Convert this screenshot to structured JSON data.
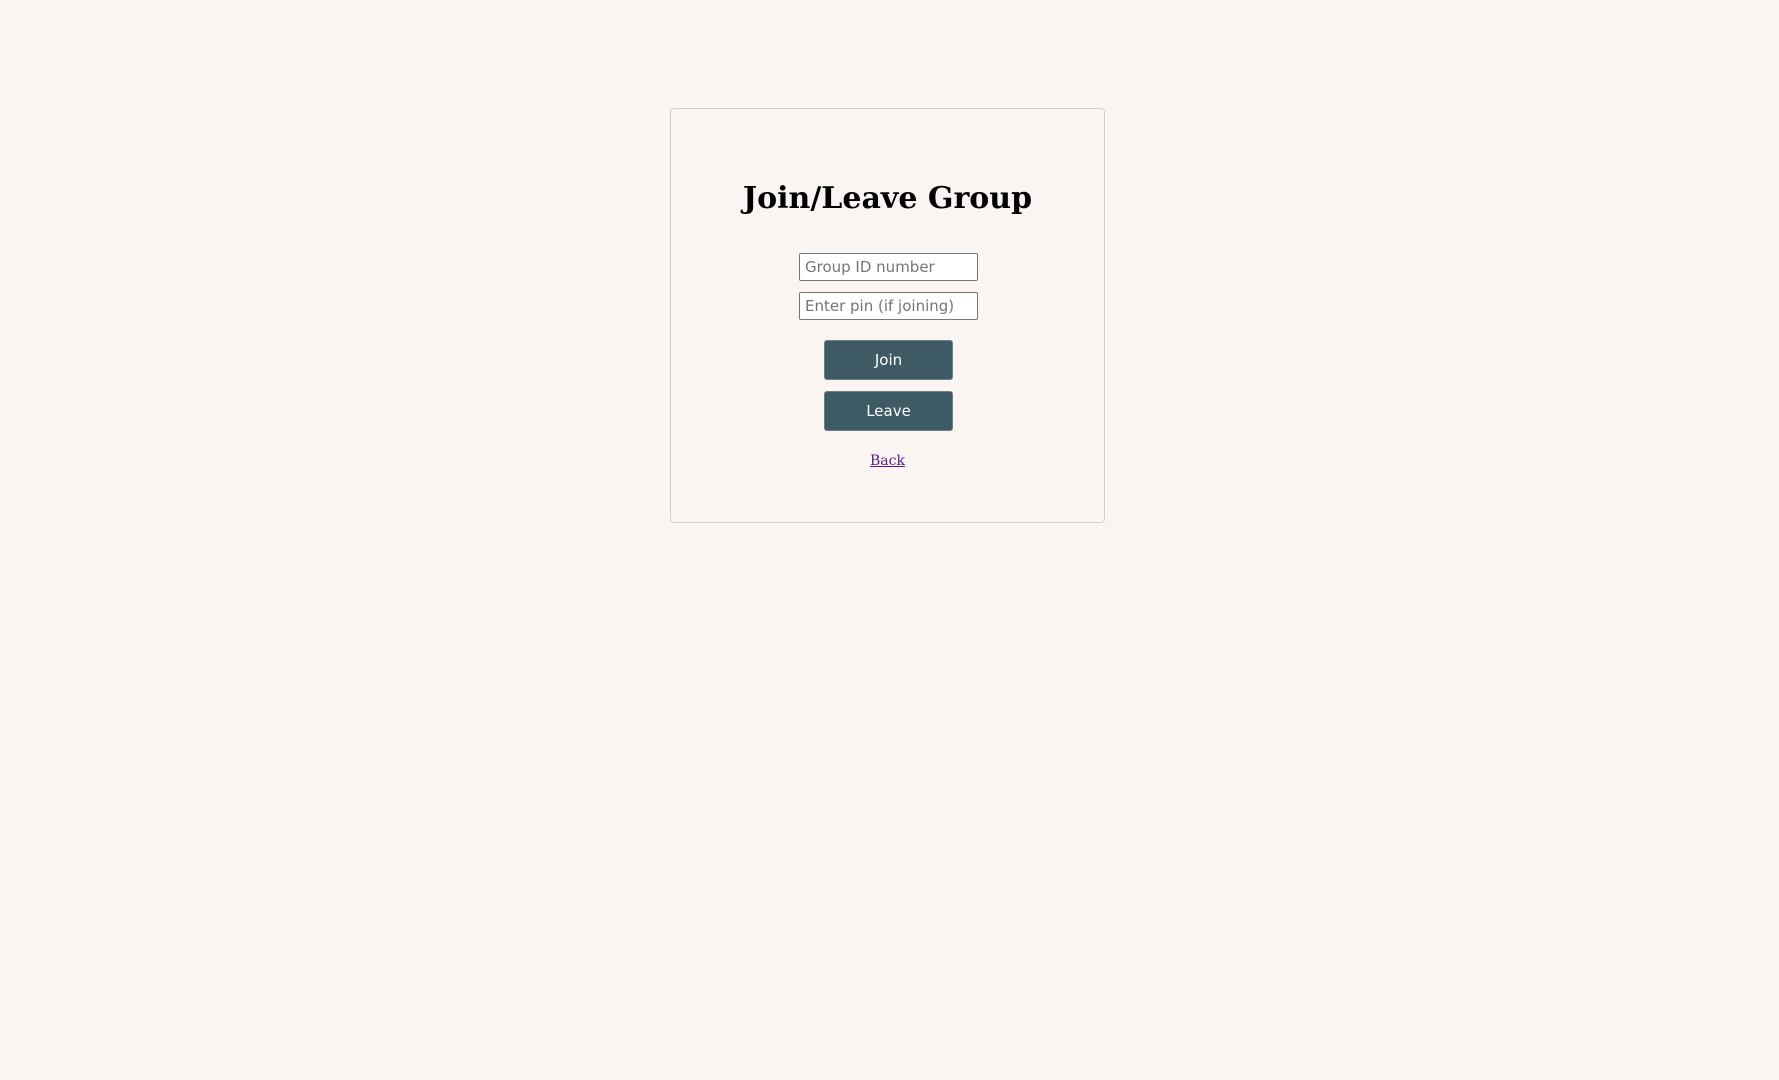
{
  "card": {
    "title": "Join/Leave Group"
  },
  "form": {
    "group_id_placeholder": "Group ID number",
    "group_id_value": "",
    "pin_placeholder": "Enter pin (if joining)",
    "pin_value": ""
  },
  "actions": {
    "join_label": "Join",
    "leave_label": "Leave",
    "back_label": "Back"
  },
  "colors": {
    "page_background": "#faf5f2",
    "button_background": "#3d5a65",
    "button_text": "#ffffff",
    "link": "#551a8b"
  }
}
